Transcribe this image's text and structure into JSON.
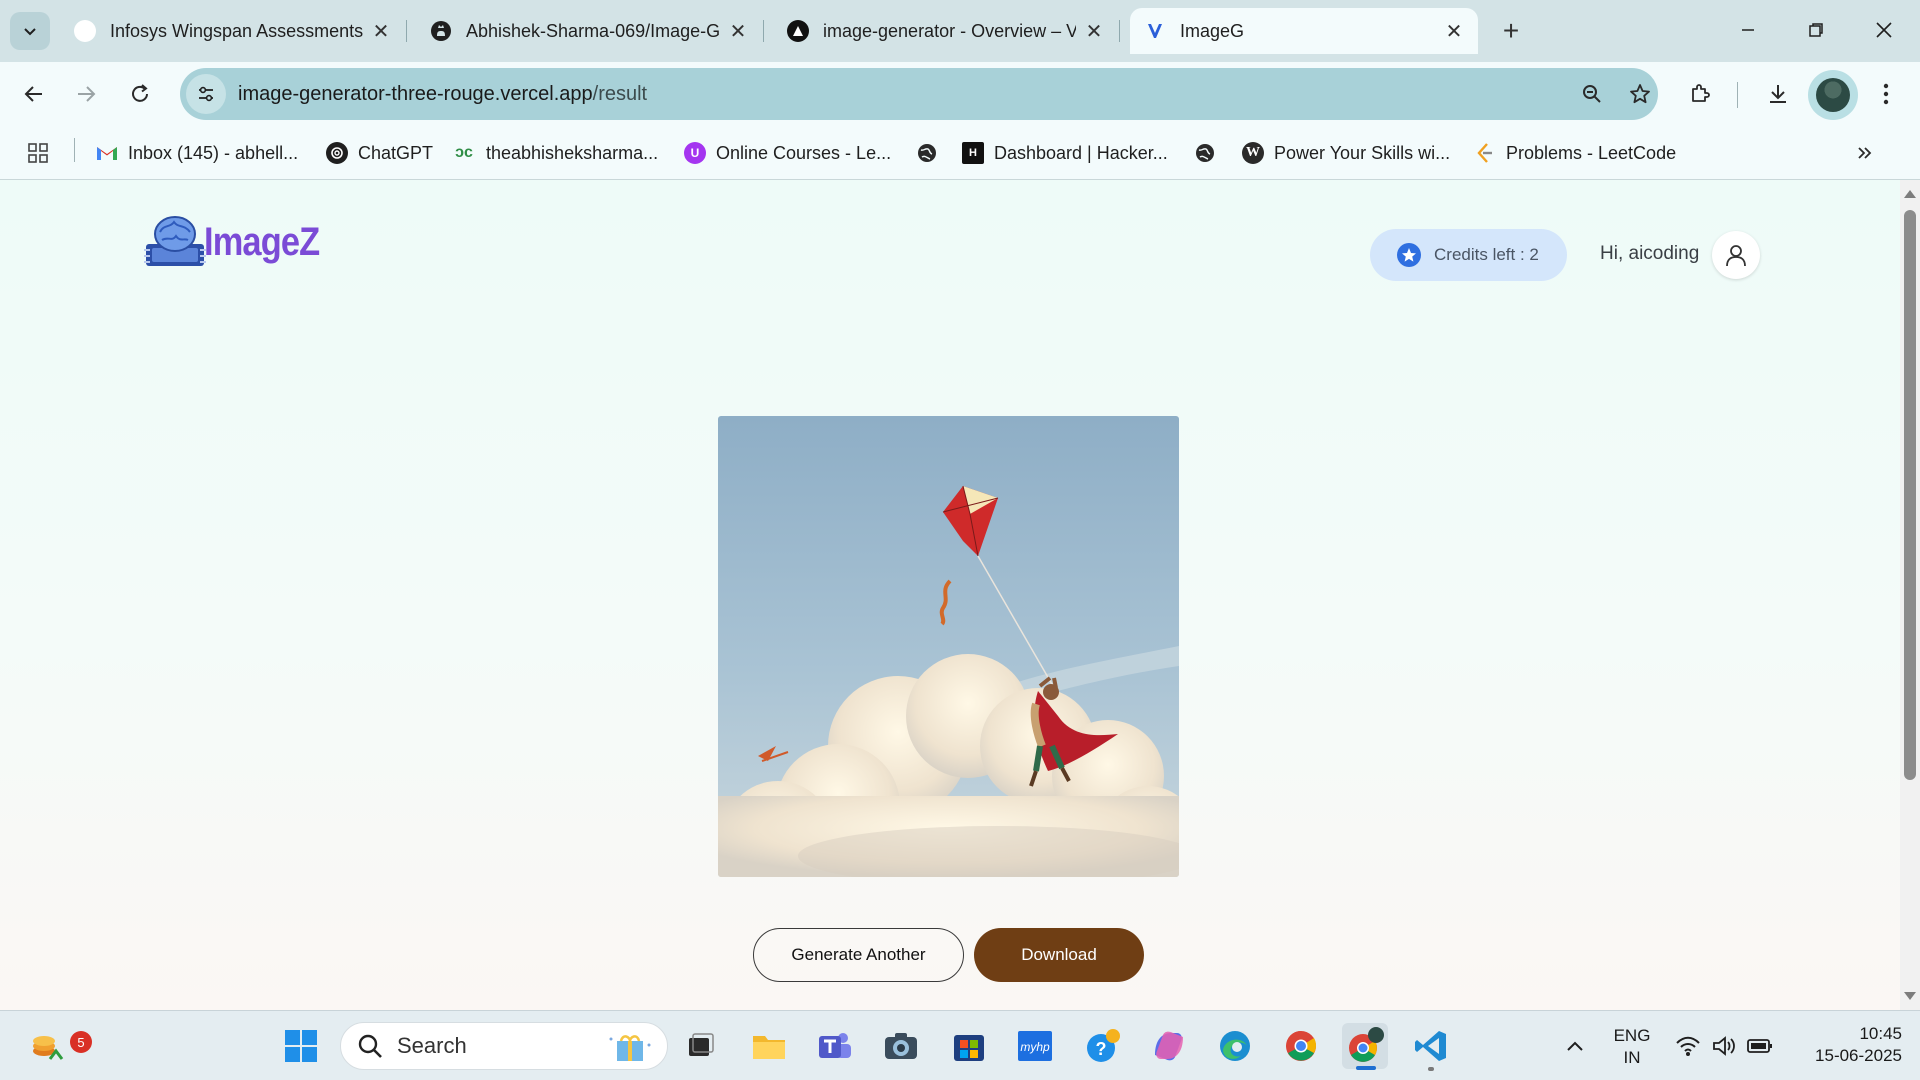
{
  "browser": {
    "tabs": [
      {
        "title": "Infosys Wingspan Assessments",
        "favicon": "wingspan-icon"
      },
      {
        "title": "Abhishek-Sharma-069/Image-G",
        "favicon": "github-icon"
      },
      {
        "title": "image-generator - Overview – V",
        "favicon": "vercel-icon"
      },
      {
        "title": "ImageG",
        "favicon": "imagez-icon",
        "active": true
      }
    ],
    "address": {
      "domain": "image-generator-three-rouge.vercel.app",
      "path": "/result"
    },
    "bookmarks": [
      {
        "label": "Inbox (145) - abhell...",
        "icon": "gmail-icon"
      },
      {
        "label": "ChatGPT",
        "icon": "chatgpt-icon"
      },
      {
        "label": "theabhisheksharma...",
        "icon": "gfg-icon"
      },
      {
        "label": "Online Courses - Le...",
        "icon": "udemy-icon"
      },
      {
        "label": "",
        "icon": "globe-icon"
      },
      {
        "label": "Dashboard | Hacker...",
        "icon": "hackerrank-icon"
      },
      {
        "label": "",
        "icon": "globe-icon"
      },
      {
        "label": "Power Your Skills wi...",
        "icon": "wordpress-icon"
      },
      {
        "label": "Problems - LeetCode",
        "icon": "leetcode-icon"
      }
    ]
  },
  "app": {
    "logo_text": "ImageZ",
    "credits_label": "Credits left : 2",
    "greeting": "Hi, aicoding",
    "image_alt": "Generated image of a figure in red cape flying with a kite among clouds",
    "buttons": {
      "generate_another": "Generate Another",
      "download": "Download"
    },
    "colors": {
      "logo": "#7b4bd6",
      "download_button": "#6f3e14",
      "credits_badge": "#d4e6fb",
      "credits_star": "#2f6fe0"
    }
  },
  "taskbar": {
    "search_placeholder": "Search",
    "notification_count": "5",
    "language": {
      "line1": "ENG",
      "line2": "IN"
    },
    "time": "10:45",
    "date": "15-06-2025"
  }
}
